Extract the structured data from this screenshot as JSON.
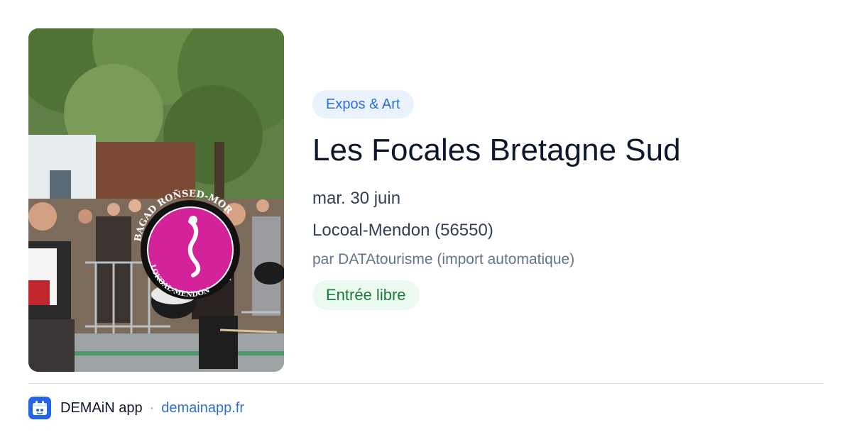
{
  "event": {
    "category": "Expos & Art",
    "title": "Les Focales Bretagne Sud",
    "date": "mar. 30 juin",
    "location": "Locoal-Mendon (56550)",
    "author": "par DATAtourisme (import automatique)",
    "price": "Entrée libre"
  },
  "photo": {
    "drum_text_top": "BAGAD ROÑSED-MOR",
    "drum_text_bottom": "LOKOAL-MENDON"
  },
  "footer": {
    "app_name": "DEMAiN app",
    "separator": "·",
    "url": "demainapp.fr",
    "icon": "demain-app-icon"
  },
  "colors": {
    "tag_bg": "#eaf2fd",
    "tag_text": "#2f6fd1",
    "price_bg": "#eafaef",
    "price_text": "#1f7a3d",
    "link": "#2f6fd1"
  }
}
